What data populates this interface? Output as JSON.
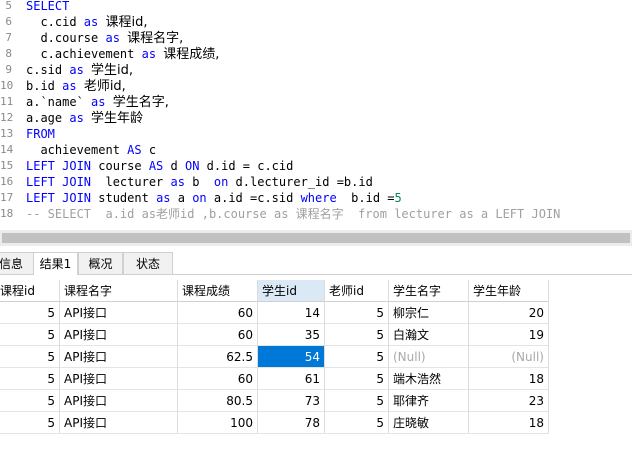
{
  "editor": {
    "lines": [
      {
        "num": "5",
        "segments": [
          {
            "t": "SELECT",
            "c": "kw"
          }
        ]
      },
      {
        "num": "6",
        "segments": [
          {
            "t": "  c.cid ",
            "c": ""
          },
          {
            "t": "as",
            "c": "kw"
          },
          {
            "t": " ",
            "c": ""
          },
          {
            "t": "课程id,",
            "c": "cjk"
          }
        ]
      },
      {
        "num": "7",
        "segments": [
          {
            "t": "  d.course ",
            "c": ""
          },
          {
            "t": "as",
            "c": "kw"
          },
          {
            "t": " ",
            "c": ""
          },
          {
            "t": "课程名字,",
            "c": "cjk"
          }
        ]
      },
      {
        "num": "8",
        "segments": [
          {
            "t": "  c.achievement ",
            "c": ""
          },
          {
            "t": "as",
            "c": "kw"
          },
          {
            "t": " ",
            "c": ""
          },
          {
            "t": "课程成绩,",
            "c": "cjk"
          }
        ]
      },
      {
        "num": "9",
        "segments": [
          {
            "t": "c.sid ",
            "c": ""
          },
          {
            "t": "as",
            "c": "kw"
          },
          {
            "t": " ",
            "c": ""
          },
          {
            "t": "学生id,",
            "c": "cjk"
          }
        ]
      },
      {
        "num": "10",
        "segments": [
          {
            "t": "b.id ",
            "c": ""
          },
          {
            "t": "as",
            "c": "kw"
          },
          {
            "t": " ",
            "c": ""
          },
          {
            "t": "老师id,",
            "c": "cjk"
          }
        ]
      },
      {
        "num": "11",
        "segments": [
          {
            "t": "a.`name` ",
            "c": ""
          },
          {
            "t": "as",
            "c": "kw"
          },
          {
            "t": " ",
            "c": ""
          },
          {
            "t": "学生名字,",
            "c": "cjk"
          }
        ]
      },
      {
        "num": "12",
        "segments": [
          {
            "t": "a.age ",
            "c": ""
          },
          {
            "t": "as",
            "c": "kw"
          },
          {
            "t": " ",
            "c": ""
          },
          {
            "t": "学生年龄",
            "c": "cjk"
          }
        ]
      },
      {
        "num": "13",
        "segments": [
          {
            "t": "FROM",
            "c": "kw"
          }
        ]
      },
      {
        "num": "14",
        "segments": [
          {
            "t": "  achievement ",
            "c": ""
          },
          {
            "t": "AS",
            "c": "kw"
          },
          {
            "t": " c",
            "c": ""
          }
        ]
      },
      {
        "num": "15",
        "segments": [
          {
            "t": "LEFT JOIN",
            "c": "kw"
          },
          {
            "t": " course ",
            "c": ""
          },
          {
            "t": "AS",
            "c": "kw"
          },
          {
            "t": " d ",
            "c": ""
          },
          {
            "t": "ON",
            "c": "kw"
          },
          {
            "t": " d.id = c.cid",
            "c": ""
          }
        ]
      },
      {
        "num": "16",
        "segments": [
          {
            "t": "LEFT JOIN",
            "c": "kw"
          },
          {
            "t": "  lecturer ",
            "c": ""
          },
          {
            "t": "as",
            "c": "kw"
          },
          {
            "t": " b  ",
            "c": ""
          },
          {
            "t": "on",
            "c": "kw"
          },
          {
            "t": " d.lecturer_id =b.id",
            "c": ""
          }
        ]
      },
      {
        "num": "17",
        "segments": [
          {
            "t": "LEFT JOIN",
            "c": "kw"
          },
          {
            "t": " student ",
            "c": ""
          },
          {
            "t": "as",
            "c": "kw"
          },
          {
            "t": " a ",
            "c": ""
          },
          {
            "t": "on",
            "c": "kw"
          },
          {
            "t": " a.id =c.sid ",
            "c": ""
          },
          {
            "t": "where",
            "c": "kw"
          },
          {
            "t": "  b.id =",
            "c": ""
          },
          {
            "t": "5",
            "c": "num"
          }
        ]
      },
      {
        "num": "18",
        "segments": [
          {
            "t": "-- SELECT  a.id as老师id ,b.course as 课程名字  from lecturer as a LEFT JOIN",
            "c": "cmt"
          }
        ]
      }
    ]
  },
  "tabs": [
    {
      "label": "信息",
      "active": false
    },
    {
      "label": "结果1",
      "active": true
    },
    {
      "label": "概况",
      "active": false
    },
    {
      "label": "状态",
      "active": false
    }
  ],
  "grid": {
    "columns": [
      "课程id",
      "课程名字",
      "课程成绩",
      "学生id",
      "老师id",
      "学生名字",
      "学生年龄"
    ],
    "selected_column": 3,
    "rows": [
      [
        "5",
        "API接口",
        "60",
        "14",
        "5",
        "柳宗仁",
        "20"
      ],
      [
        "5",
        "API接口",
        "60",
        "35",
        "5",
        "白瀚文",
        "19"
      ],
      [
        "5",
        "API接口",
        "62.5",
        "54",
        "5",
        "(Null)",
        "(Null)"
      ],
      [
        "5",
        "API接口",
        "60",
        "61",
        "5",
        "端木浩然",
        "18"
      ],
      [
        "5",
        "API接口",
        "80.5",
        "73",
        "5",
        "耶律齐",
        "23"
      ],
      [
        "5",
        "API接口",
        "100",
        "78",
        "5",
        "庄晓敏",
        "18"
      ]
    ],
    "selected_cell": {
      "row": 2,
      "col": 3
    }
  }
}
